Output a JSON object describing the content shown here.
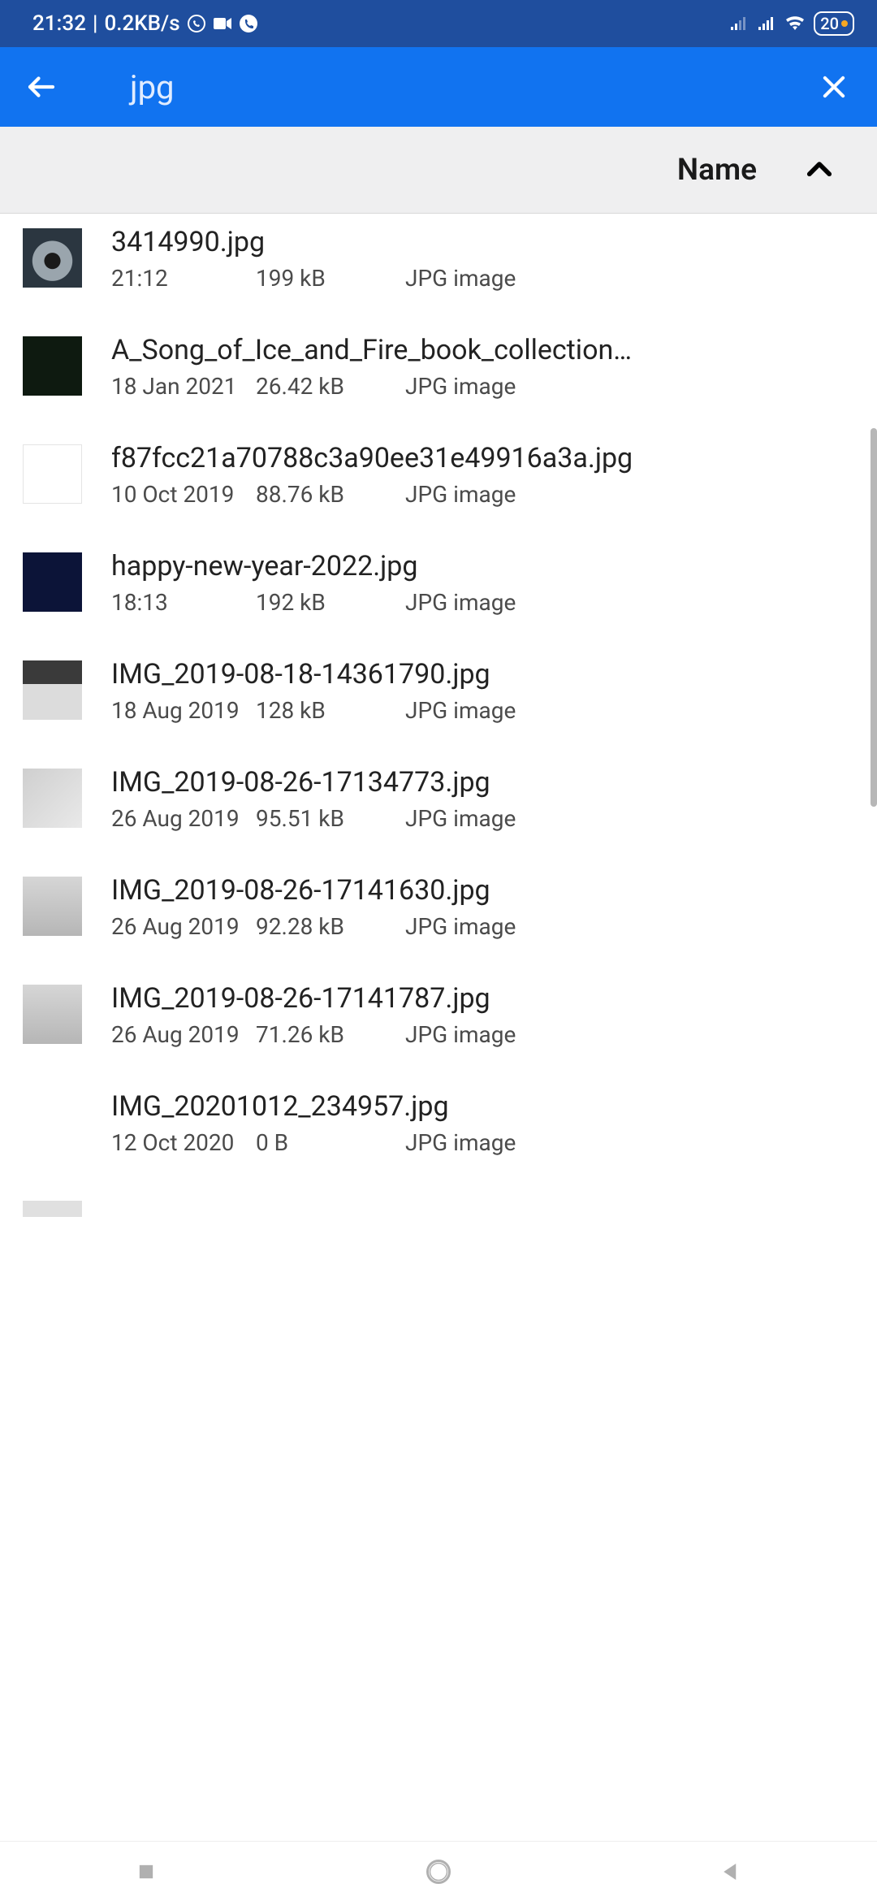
{
  "statusbar": {
    "time": "21:32",
    "speed": "0.2KB/s",
    "battery": "20"
  },
  "appbar": {
    "search_query": "jpg"
  },
  "sortbar": {
    "label": "Name"
  },
  "files": [
    {
      "name": "3414990.jpg",
      "date": "21:12",
      "size": "199 kB",
      "type": "JPG image"
    },
    {
      "name": "A_Song_of_Ice_and_Fire_book_collection…",
      "date": "18 Jan 2021",
      "size": "26.42 kB",
      "type": "JPG image"
    },
    {
      "name": "f87fcc21a70788c3a90ee31e49916a3a.jpg",
      "date": "10 Oct 2019",
      "size": "88.76 kB",
      "type": "JPG image"
    },
    {
      "name": "happy-new-year-2022.jpg",
      "date": "18:13",
      "size": "192 kB",
      "type": "JPG image"
    },
    {
      "name": "IMG_2019-08-18-14361790.jpg",
      "date": "18 Aug 2019",
      "size": "128 kB",
      "type": "JPG image"
    },
    {
      "name": "IMG_2019-08-26-17134773.jpg",
      "date": "26 Aug 2019",
      "size": "95.51 kB",
      "type": "JPG image"
    },
    {
      "name": "IMG_2019-08-26-17141630.jpg",
      "date": "26 Aug 2019",
      "size": "92.28 kB",
      "type": "JPG image"
    },
    {
      "name": "IMG_2019-08-26-17141787.jpg",
      "date": "26 Aug 2019",
      "size": "71.26 kB",
      "type": "JPG image"
    },
    {
      "name": "IMG_20201012_234957.jpg",
      "date": "12 Oct 2020",
      "size": "0 B",
      "type": "JPG image"
    }
  ]
}
